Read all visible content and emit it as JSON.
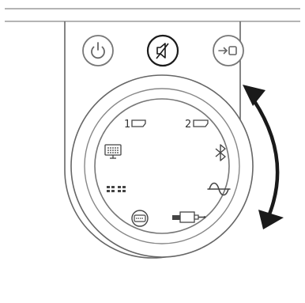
{
  "diagram": {
    "colors": {
      "outline": "#555555",
      "light_line": "#888888",
      "icon": "#333333",
      "arrow": "#1a1a1a",
      "background": "#ffffff"
    },
    "top_buttons": [
      {
        "name": "power-button",
        "icon": "power-icon",
        "highlighted": false
      },
      {
        "name": "mute-button",
        "icon": "speaker-muted-icon",
        "highlighted": true
      },
      {
        "name": "input-button",
        "icon": "arrow-to-box-icon",
        "highlighted": false
      }
    ],
    "dial_sources": [
      {
        "name": "source-1",
        "icon": "hdmi-input-icon",
        "label": "1"
      },
      {
        "name": "source-2",
        "icon": "hdmi-input-icon",
        "label": "2"
      },
      {
        "name": "source-bluetooth",
        "icon": "bluetooth-icon",
        "label": ""
      },
      {
        "name": "source-analog",
        "icon": "sine-wave-icon",
        "label": ""
      },
      {
        "name": "source-aux",
        "icon": "aux-cable-icon",
        "label": ""
      },
      {
        "name": "source-optical",
        "icon": "optical-input-icon",
        "label": ""
      },
      {
        "name": "source-network",
        "icon": "network-icon",
        "label": ""
      },
      {
        "name": "source-tv",
        "icon": "tv-icon",
        "label": ""
      }
    ],
    "rotation_indicator": {
      "icon": "double-headed-curved-arrow-icon",
      "meaning": "rotate dial"
    }
  }
}
